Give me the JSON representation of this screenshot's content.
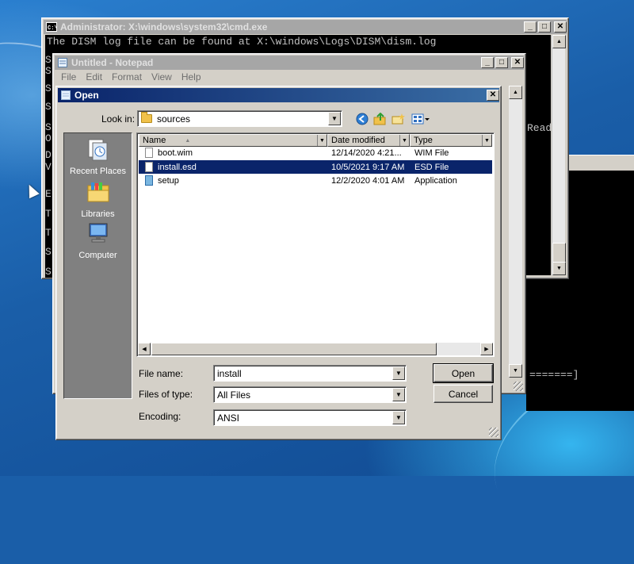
{
  "cmd": {
    "title": "Administrator: X:\\windows\\system32\\cmd.exe",
    "first_line": "The DISM log file can be found at X:\\windows\\Logs\\DISM\\dism.log",
    "left_chars": [
      "S",
      "S",
      "S",
      "S",
      "S",
      "O",
      "D",
      "V",
      "E",
      "T",
      "T",
      "S",
      "S"
    ],
    "right_text": "Read"
  },
  "background_console": {
    "progress_text": "=======]"
  },
  "notepad": {
    "title": "Untitled - Notepad",
    "menu": [
      "File",
      "Edit",
      "Format",
      "View",
      "Help"
    ]
  },
  "open_dialog": {
    "title": "Open",
    "look_in_label": "Look in:",
    "look_in_value": "sources",
    "places": [
      {
        "label": "Recent Places",
        "icon": "recent-places-icon"
      },
      {
        "label": "Libraries",
        "icon": "libraries-icon"
      },
      {
        "label": "Computer",
        "icon": "computer-icon"
      }
    ],
    "columns": [
      "Name",
      "Date modified",
      "Type"
    ],
    "files": [
      {
        "name": "boot.wim",
        "date": "12/14/2020 4:21...",
        "type": "WIM File",
        "icon": "file-icon",
        "selected": false
      },
      {
        "name": "install.esd",
        "date": "10/5/2021 9:17 AM",
        "type": "ESD File",
        "icon": "file-icon",
        "selected": true
      },
      {
        "name": "setup",
        "date": "12/2/2020 4:01 AM",
        "type": "Application",
        "icon": "setup-app-icon",
        "selected": false
      }
    ],
    "file_name_label": "File name:",
    "file_name_value": "install",
    "file_type_label": "Files of type:",
    "file_type_value": "All Files",
    "encoding_label": "Encoding:",
    "encoding_value": "ANSI",
    "open_button": "Open",
    "cancel_button": "Cancel"
  },
  "colors": {
    "title_active": "#0a246a",
    "title_inactive": "#a6a6a6",
    "selection": "#0a246a",
    "face": "#d4d0c8"
  }
}
